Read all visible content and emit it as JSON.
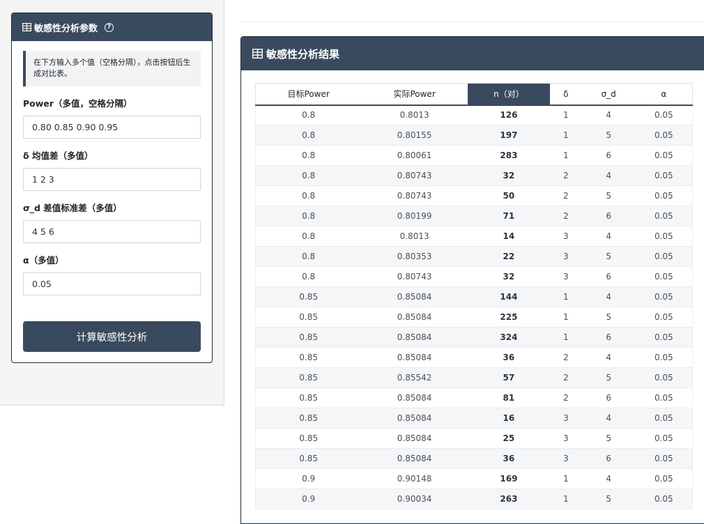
{
  "params": {
    "title": "敏感性分析参数",
    "help_icon": "?",
    "info": "在下方输入多个值（空格分隔），点击按钮后生成对比表。",
    "fields": [
      {
        "label": "Power（多值，空格分隔）",
        "value": "0.80 0.85 0.90 0.95"
      },
      {
        "label": "δ 均值差（多值）",
        "value": "1 2 3"
      },
      {
        "label": "σ_d 差值标准差（多值）",
        "value": "4 5 6"
      },
      {
        "label": "α（多值）",
        "value": "0.05"
      }
    ],
    "button_label": "计算敏感性分析"
  },
  "results": {
    "title": "敏感性分析结果",
    "columns": [
      "目标Power",
      "实际Power",
      "n（对）",
      "δ",
      "σ_d",
      "α"
    ],
    "active_column": 2,
    "rows": [
      [
        "0.8",
        "0.8013",
        "126",
        "1",
        "4",
        "0.05"
      ],
      [
        "0.8",
        "0.80155",
        "197",
        "1",
        "5",
        "0.05"
      ],
      [
        "0.8",
        "0.80061",
        "283",
        "1",
        "6",
        "0.05"
      ],
      [
        "0.8",
        "0.80743",
        "32",
        "2",
        "4",
        "0.05"
      ],
      [
        "0.8",
        "0.80743",
        "50",
        "2",
        "5",
        "0.05"
      ],
      [
        "0.8",
        "0.80199",
        "71",
        "2",
        "6",
        "0.05"
      ],
      [
        "0.8",
        "0.8013",
        "14",
        "3",
        "4",
        "0.05"
      ],
      [
        "0.8",
        "0.80353",
        "22",
        "3",
        "5",
        "0.05"
      ],
      [
        "0.8",
        "0.80743",
        "32",
        "3",
        "6",
        "0.05"
      ],
      [
        "0.85",
        "0.85084",
        "144",
        "1",
        "4",
        "0.05"
      ],
      [
        "0.85",
        "0.85084",
        "225",
        "1",
        "5",
        "0.05"
      ],
      [
        "0.85",
        "0.85084",
        "324",
        "1",
        "6",
        "0.05"
      ],
      [
        "0.85",
        "0.85084",
        "36",
        "2",
        "4",
        "0.05"
      ],
      [
        "0.85",
        "0.85542",
        "57",
        "2",
        "5",
        "0.05"
      ],
      [
        "0.85",
        "0.85084",
        "81",
        "2",
        "6",
        "0.05"
      ],
      [
        "0.85",
        "0.85084",
        "16",
        "3",
        "4",
        "0.05"
      ],
      [
        "0.85",
        "0.85084",
        "25",
        "3",
        "5",
        "0.05"
      ],
      [
        "0.85",
        "0.85084",
        "36",
        "3",
        "6",
        "0.05"
      ],
      [
        "0.9",
        "0.90148",
        "169",
        "1",
        "4",
        "0.05"
      ],
      [
        "0.9",
        "0.90034",
        "263",
        "1",
        "5",
        "0.05"
      ]
    ]
  },
  "icons": {
    "header_icon": "table-grid-icon",
    "help": "question-circle-icon"
  }
}
